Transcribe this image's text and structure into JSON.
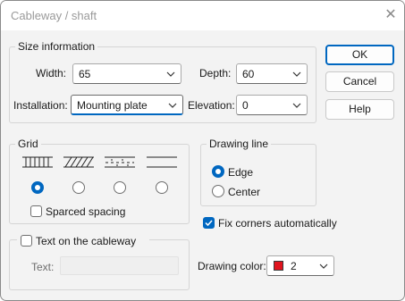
{
  "window": {
    "title": "Cableway / shaft",
    "close_glyph": "✕"
  },
  "size_info": {
    "legend": "Size information",
    "width_label": "Width:",
    "width_value": "65",
    "depth_label": "Depth:",
    "depth_value": "60",
    "installation_label": "Installation:",
    "installation_value": "Mounting plate",
    "elevation_label": "Elevation:",
    "elevation_value": "0"
  },
  "buttons": {
    "ok": "OK",
    "cancel": "Cancel",
    "help": "Help"
  },
  "grid": {
    "legend": "Grid",
    "options": [
      {
        "icon": "vertical-lines-grid-icon",
        "selected": true
      },
      {
        "icon": "diagonal-hatch-grid-icon",
        "selected": false
      },
      {
        "icon": "dashed-grid-icon",
        "selected": false
      },
      {
        "icon": "plain-lines-grid-icon",
        "selected": false
      }
    ],
    "spaced_label": "Sparced spacing",
    "spaced_checked": false
  },
  "drawing_line": {
    "legend": "Drawing line",
    "edge_label": "Edge",
    "edge_selected": true,
    "center_label": "Center",
    "center_selected": false
  },
  "fix_corners": {
    "label": "Fix corners automatically",
    "checked": true
  },
  "text_group": {
    "legend": "Text on the cableway",
    "checked": false,
    "text_label": "Text:",
    "text_value": ""
  },
  "drawing_color": {
    "label": "Drawing color:",
    "value": "2",
    "swatch_color": "#e0141e"
  },
  "colors": {
    "accent": "#0067c0"
  }
}
